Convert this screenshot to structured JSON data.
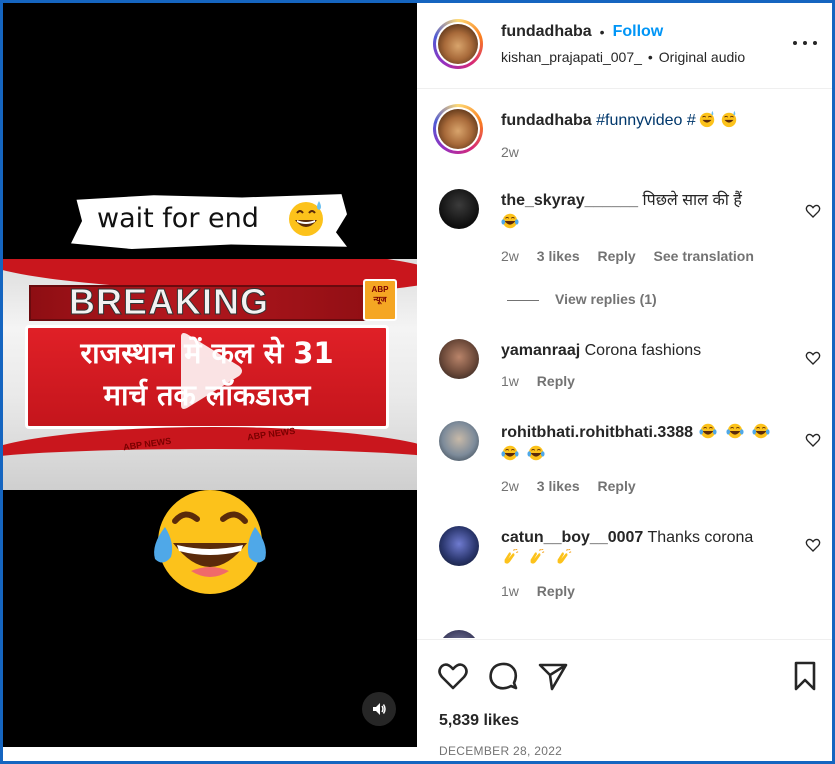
{
  "video": {
    "overlay_caption": "wait for end",
    "news": {
      "breaking": "BREAKING",
      "channel_logo": "ABP न्यूज",
      "headline_line1": "राजस्थान में कल से 31",
      "headline_line2": "मार्च तक लॉकडाउन",
      "strip_text": "ABP NEWS"
    },
    "play_icon": "play-icon",
    "volume_icon": "speaker-icon"
  },
  "post": {
    "author": "fundadhaba",
    "follow_label": "Follow",
    "audio_user": "kishan_prajapati_007_",
    "audio_label": "Original audio",
    "caption_user": "fundadhaba",
    "caption_text": "#funnyvideo #",
    "caption_time": "2w"
  },
  "comments": [
    {
      "user": "the_skyray______",
      "text": "पिछले साल की हैं",
      "time": "2w",
      "likes": "3 likes",
      "reply": "Reply",
      "translate": "See translation",
      "view_replies": "View replies (1)"
    },
    {
      "user": "yamanraaj",
      "text": "Corona fashions",
      "time": "1w",
      "reply": "Reply"
    },
    {
      "user": "rohitbhati.rohitbhati.3388",
      "text": "",
      "time": "2w",
      "likes": "3 likes",
      "reply": "Reply"
    },
    {
      "user": "catun__boy__0007",
      "text": "Thanks corona",
      "time": "1w",
      "reply": "Reply"
    }
  ],
  "footer": {
    "likes": "5,839 likes",
    "date": "DECEMBER 28, 2022"
  },
  "colors": {
    "accent": "#0095f6",
    "text": "#262626",
    "muted": "#737373",
    "news_red": "#d01a21",
    "border_blue": "#1565c0"
  }
}
